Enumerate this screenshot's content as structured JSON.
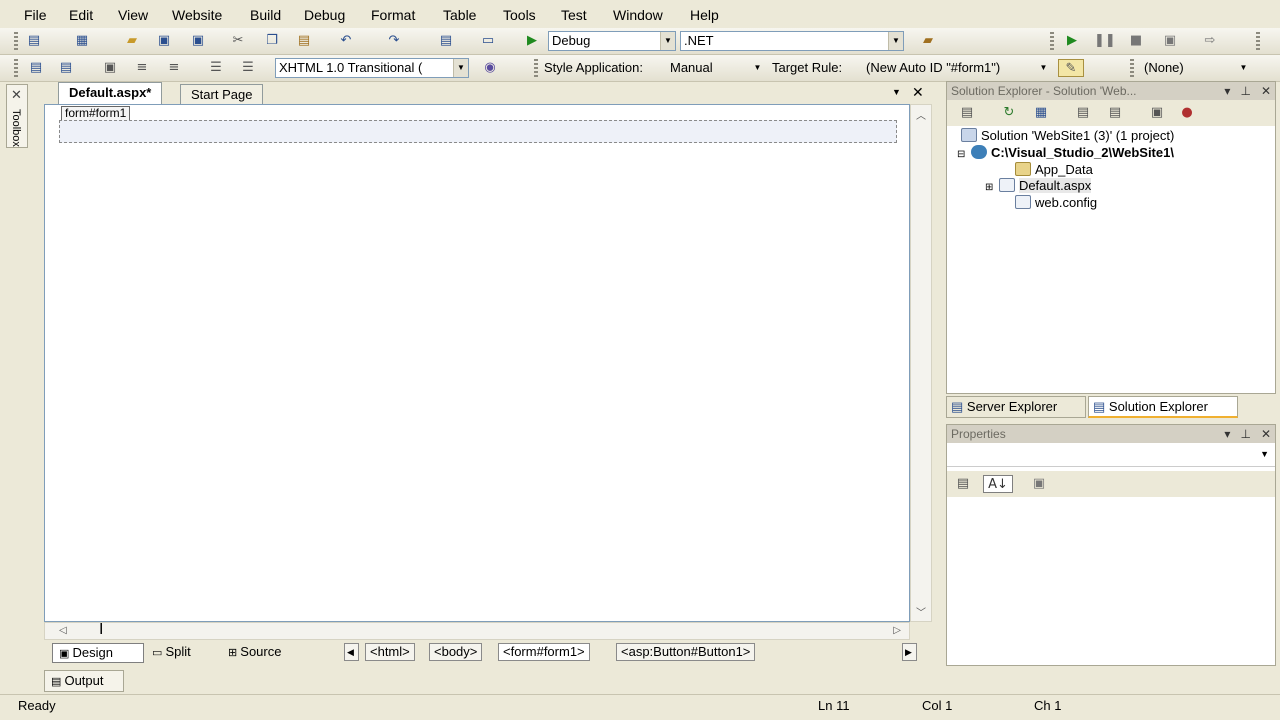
{
  "menu": [
    "File",
    "Edit",
    "View",
    "Website",
    "Build",
    "Debug",
    "Format",
    "Table",
    "Tools",
    "Test",
    "Window",
    "Help"
  ],
  "toolbar1": {
    "config_value": "Debug",
    "platform_value": ".NET"
  },
  "toolbar2": {
    "doctype_value": "XHTML 1.0 Transitional (",
    "style_app_label": "Style Application:",
    "style_app_value": "Manual",
    "target_rule_label": "Target Rule:",
    "target_rule_value": "(New Auto ID \"#form1\")",
    "none_value": "(None)"
  },
  "toolbox_label": "Toolbox",
  "doc": {
    "tabs": [
      "Default.aspx*",
      "Start Page"
    ],
    "form_tag": "form#form1"
  },
  "view_buttons": [
    "Design",
    "Split",
    "Source"
  ],
  "breadcrumbs": [
    "<html>",
    "<body>",
    "<form#form1>",
    "<asp:Button#Button1>"
  ],
  "output_label": "Output",
  "status": {
    "ready": "Ready",
    "ln": "Ln 11",
    "col": "Col 1",
    "ch": "Ch 1"
  },
  "solution_explorer": {
    "title": "Solution Explorer - Solution 'Web...",
    "items": [
      "Solution 'WebSite1 (3)' (1 project)",
      "C:\\Visual_Studio_2\\WebSite1\\",
      "App_Data",
      "Default.aspx",
      "web.config"
    ]
  },
  "pane_tabs": [
    "Server Explorer",
    "Solution Explorer"
  ],
  "properties": {
    "title": "Properties"
  }
}
